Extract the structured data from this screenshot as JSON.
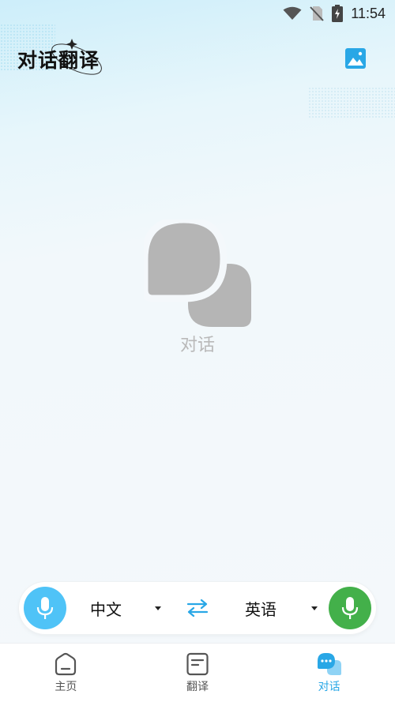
{
  "status_bar": {
    "time": "11:54"
  },
  "header": {
    "title": "对话翻译"
  },
  "empty_state": {
    "label": "对话"
  },
  "language_bar": {
    "source_language": "中文",
    "target_language": "英语"
  },
  "bottom_nav": {
    "items": [
      {
        "label": "主页",
        "icon": "home-icon",
        "active": false
      },
      {
        "label": "翻译",
        "icon": "document-icon",
        "active": false
      },
      {
        "label": "对话",
        "icon": "chat-bubbles-icon",
        "active": true
      }
    ]
  },
  "colors": {
    "accent": "#29a7e6",
    "mic_source": "#4fc3f7",
    "mic_target": "#43b04a",
    "empty_icon": "#b5b5b5"
  }
}
